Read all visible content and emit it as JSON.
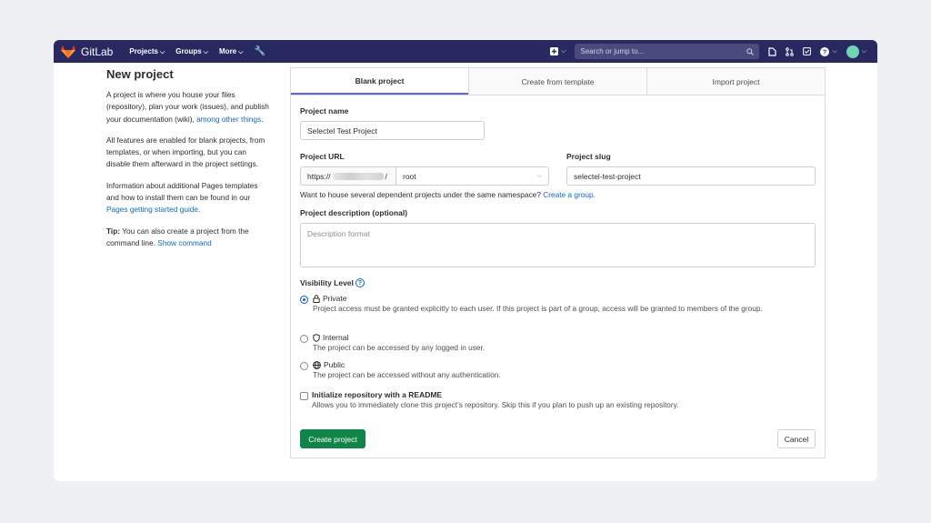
{
  "navbar": {
    "brand": "GitLab",
    "menu": [
      "Projects",
      "Groups",
      "More"
    ],
    "search_placeholder": "Search or jump to...",
    "colors": {
      "bg": "#292961",
      "accent": "#fc6d26"
    }
  },
  "sidebar": {
    "title": "New project",
    "p1_text": "A project is where you house your files (repository), plan your work (issues), and publish your documentation (wiki),",
    "p1_link": "among other things",
    "p1_end": ".",
    "p2_text": "All features are enabled for blank projects, from templates, or when importing, but you can disable them afterward in the project settings.",
    "p3_text": "Information about additional Pages templates and how to install them can be found in our",
    "p3_link": "Pages getting started guide",
    "p3_end": ".",
    "tip_label": "Tip:",
    "tip_text": "You can also create a project from the command line.",
    "tip_link": "Show command"
  },
  "tabs": [
    "Blank project",
    "Create from template",
    "Import project"
  ],
  "form": {
    "name_label": "Project name",
    "name_value": "Selectel Test Project",
    "url_label": "Project URL",
    "url_prefix_start": "https://",
    "url_prefix_end": "/",
    "namespace_value": "root",
    "slug_label": "Project slug",
    "slug_value": "selectel-test-project",
    "namespace_hint": "Want to house several dependent projects under the same namespace?",
    "namespace_link": "Create a group.",
    "description_label": "Project description (optional)",
    "description_placeholder": "Description format",
    "visibility_label": "Visibility Level",
    "visibility": [
      {
        "title": "Private",
        "desc": "Project access must be granted explicitly to each user. If this project is part of a group, access will be granted to members of the group.",
        "icon": "lock-icon",
        "checked": true
      },
      {
        "title": "Internal",
        "desc": "The project can be accessed by any logged in user.",
        "icon": "shield-icon",
        "checked": false
      },
      {
        "title": "Public",
        "desc": "The project can be accessed without any authentication.",
        "icon": "globe-icon",
        "checked": false
      }
    ],
    "readme_label": "Initialize repository with a README",
    "readme_desc": "Allows you to immediately clone this project’s repository. Skip this if you plan to push up an existing repository.",
    "create_button": "Create project",
    "cancel_button": "Cancel"
  }
}
